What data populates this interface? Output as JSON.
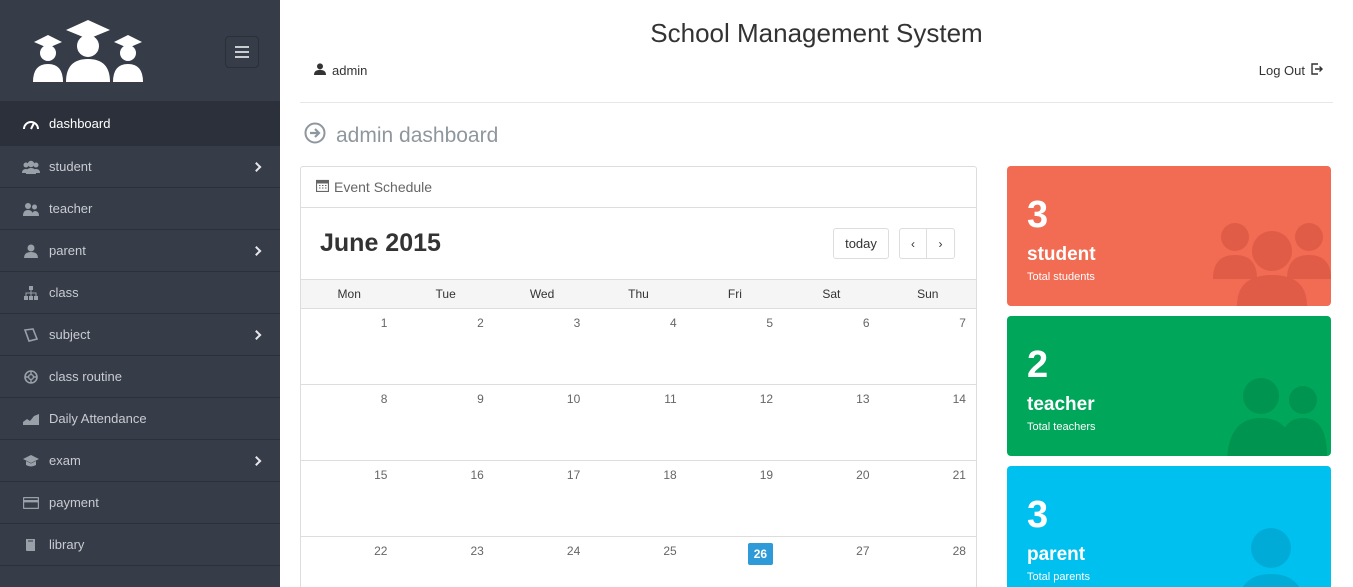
{
  "app": {
    "title": "School Management System"
  },
  "header": {
    "user": "admin",
    "logout": "Log Out"
  },
  "page": {
    "heading": "admin dashboard"
  },
  "sidebar": {
    "items": [
      {
        "label": "dashboard",
        "icon": "dashboard-icon",
        "active": true
      },
      {
        "label": "student",
        "icon": "users-icon",
        "has_submenu": true
      },
      {
        "label": "teacher",
        "icon": "user-group-icon"
      },
      {
        "label": "parent",
        "icon": "user-icon",
        "has_submenu": true
      },
      {
        "label": "class",
        "icon": "sitemap-icon"
      },
      {
        "label": "subject",
        "icon": "book-icon",
        "has_submenu": true
      },
      {
        "label": "class routine",
        "icon": "life-ring-icon"
      },
      {
        "label": "Daily Attendance",
        "icon": "chart-area-icon"
      },
      {
        "label": "exam",
        "icon": "graduation-cap-icon",
        "has_submenu": true
      },
      {
        "label": "payment",
        "icon": "credit-card-icon"
      },
      {
        "label": "library",
        "icon": "book-icon"
      }
    ]
  },
  "calendar": {
    "panel_title": "Event Schedule",
    "month_title": "June 2015",
    "today_label": "today",
    "prev_label": "‹",
    "next_label": "›",
    "weekdays": [
      "Mon",
      "Tue",
      "Wed",
      "Thu",
      "Fri",
      "Sat",
      "Sun"
    ],
    "weeks": [
      [
        "1",
        "2",
        "3",
        "4",
        "5",
        "6",
        "7"
      ],
      [
        "8",
        "9",
        "10",
        "11",
        "12",
        "13",
        "14"
      ],
      [
        "15",
        "16",
        "17",
        "18",
        "19",
        "20",
        "21"
      ],
      [
        "22",
        "23",
        "24",
        "25",
        "26",
        "27",
        "28"
      ]
    ],
    "today_date": "26"
  },
  "stats": [
    {
      "count": "3",
      "label": "student",
      "sub": "Total students",
      "color": "#f26b53",
      "icon": "users-icon"
    },
    {
      "count": "2",
      "label": "teacher",
      "sub": "Total teachers",
      "color": "#00a65a",
      "icon": "user-group-icon"
    },
    {
      "count": "3",
      "label": "parent",
      "sub": "Total parents",
      "color": "#00c0ef",
      "icon": "user-icon"
    }
  ]
}
